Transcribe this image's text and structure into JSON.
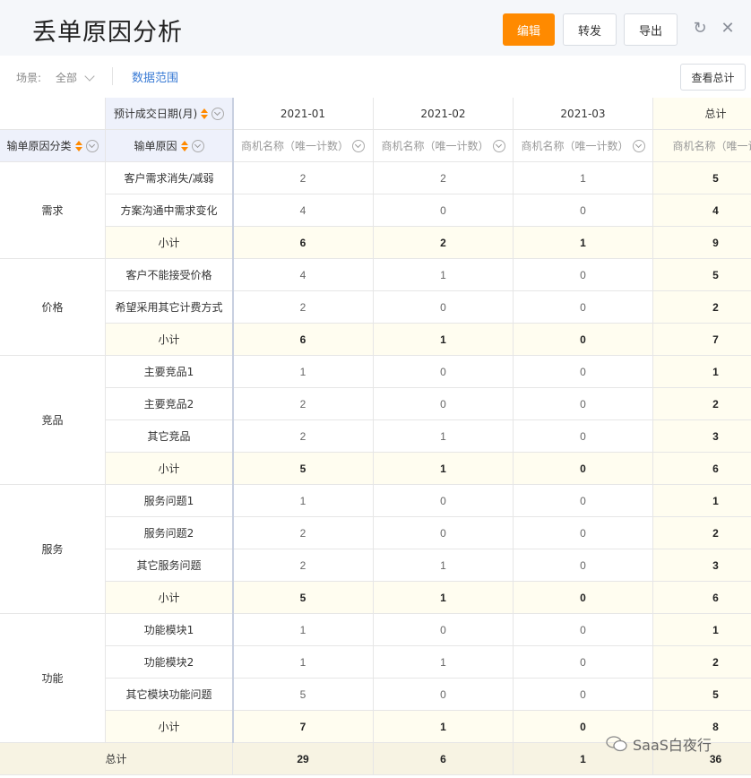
{
  "page_title": "丢单原因分析",
  "toolbar": {
    "edit": "编辑",
    "forward": "转发",
    "export": "导出"
  },
  "filters": {
    "scene_label": "场景:",
    "scene_value": "全部",
    "data_range": "数据范围",
    "view_total": "查看总计"
  },
  "columns": {
    "date_field": "预计成交日期(月)",
    "category_field": "输单原因分类",
    "reason_field": "输单原因",
    "months": [
      "2021-01",
      "2021-02",
      "2021-03"
    ],
    "total": "总计",
    "measure": "商机名称（唯一计数）",
    "measure_cut": "商机名称（唯一计"
  },
  "groups": [
    {
      "name": "需求",
      "rows": [
        {
          "reason": "客户需求消失/减弱",
          "v": [
            "2",
            "2",
            "1",
            "5"
          ]
        },
        {
          "reason": "方案沟通中需求变化",
          "v": [
            "4",
            "0",
            "0",
            "4"
          ]
        },
        {
          "reason": "小计",
          "v": [
            "6",
            "2",
            "1",
            "9"
          ],
          "subtotal": true
        }
      ]
    },
    {
      "name": "价格",
      "rows": [
        {
          "reason": "客户不能接受价格",
          "v": [
            "4",
            "1",
            "0",
            "5"
          ]
        },
        {
          "reason": "希望采用其它计费方式",
          "v": [
            "2",
            "0",
            "0",
            "2"
          ]
        },
        {
          "reason": "小计",
          "v": [
            "6",
            "1",
            "0",
            "7"
          ],
          "subtotal": true
        }
      ]
    },
    {
      "name": "竞品",
      "rows": [
        {
          "reason": "主要竞品1",
          "v": [
            "1",
            "0",
            "0",
            "1"
          ]
        },
        {
          "reason": "主要竞品2",
          "v": [
            "2",
            "0",
            "0",
            "2"
          ]
        },
        {
          "reason": "其它竞品",
          "v": [
            "2",
            "1",
            "0",
            "3"
          ]
        },
        {
          "reason": "小计",
          "v": [
            "5",
            "1",
            "0",
            "6"
          ],
          "subtotal": true
        }
      ]
    },
    {
      "name": "服务",
      "rows": [
        {
          "reason": "服务问题1",
          "v": [
            "1",
            "0",
            "0",
            "1"
          ]
        },
        {
          "reason": "服务问题2",
          "v": [
            "2",
            "0",
            "0",
            "2"
          ]
        },
        {
          "reason": "其它服务问题",
          "v": [
            "2",
            "1",
            "0",
            "3"
          ]
        },
        {
          "reason": "小计",
          "v": [
            "5",
            "1",
            "0",
            "6"
          ],
          "subtotal": true
        }
      ]
    },
    {
      "name": "功能",
      "rows": [
        {
          "reason": "功能模块1",
          "v": [
            "1",
            "0",
            "0",
            "1"
          ]
        },
        {
          "reason": "功能模块2",
          "v": [
            "1",
            "1",
            "0",
            "2"
          ]
        },
        {
          "reason": "其它模块功能问题",
          "v": [
            "5",
            "0",
            "0",
            "5"
          ]
        },
        {
          "reason": "小计",
          "v": [
            "7",
            "1",
            "0",
            "8"
          ],
          "subtotal": true
        }
      ]
    }
  ],
  "grand_total": {
    "label": "总计",
    "v": [
      "29",
      "6",
      "1",
      "36"
    ]
  },
  "watermark": "SaaS白夜行"
}
